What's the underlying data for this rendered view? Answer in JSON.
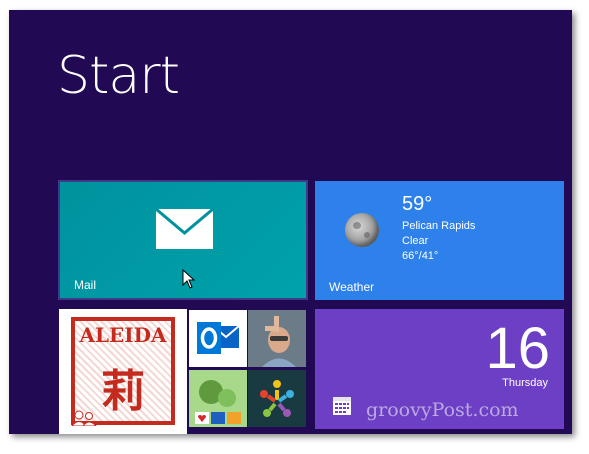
{
  "start": {
    "title": "Start"
  },
  "tiles": {
    "mail": {
      "label": "Mail",
      "icon": "envelope-icon"
    },
    "weather": {
      "label": "Weather",
      "icon": "moon-icon",
      "temperature": "59°",
      "location": "Pelican Rapids",
      "condition": "Clear",
      "high_low": "66°/41°"
    },
    "people": {
      "stamp_text": "ALEIDA",
      "stamp_char": "莉",
      "icon": "people-icon"
    },
    "outlook": {
      "icon": "outlook-icon"
    },
    "photo": {
      "icon": "person-photo"
    },
    "photo2": {
      "icon": "photo-collage"
    },
    "app": {
      "icon": "colorful-logo-icon"
    },
    "calendar": {
      "day": "16",
      "weekday": "Thursday",
      "icon": "calendar-icon"
    }
  },
  "watermark": "groovyPost.com",
  "colors": {
    "background": "#210a53",
    "mail": "#00a2ab",
    "weather": "#2e81ea",
    "calendar": "#6c3fc5"
  }
}
